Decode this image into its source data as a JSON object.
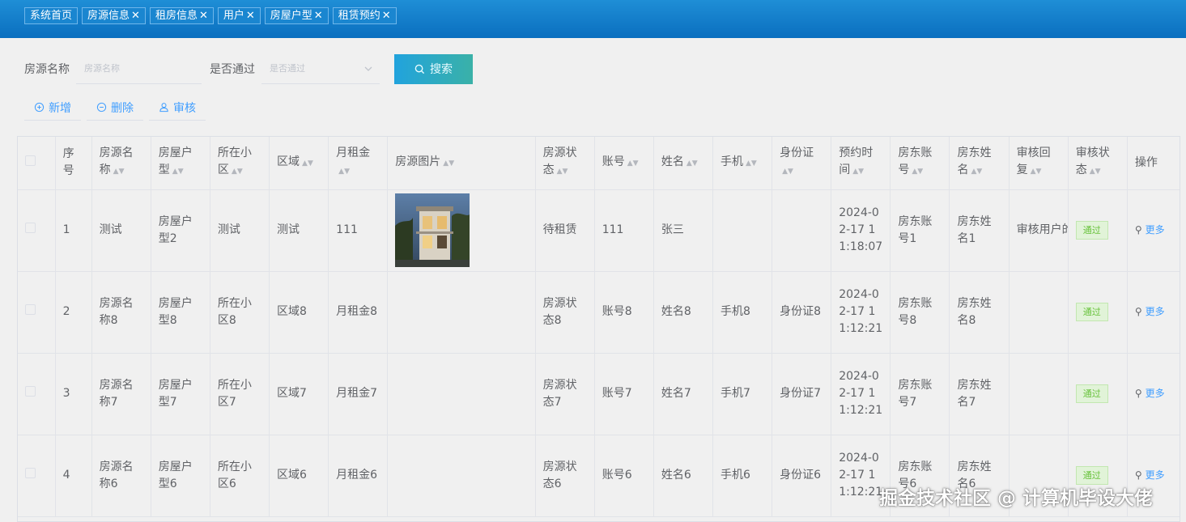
{
  "tabs": [
    {
      "label": "系统首页",
      "closable": false
    },
    {
      "label": "房源信息",
      "closable": true
    },
    {
      "label": "租房信息",
      "closable": true
    },
    {
      "label": "用户",
      "closable": true
    },
    {
      "label": "房屋户型",
      "closable": true
    },
    {
      "label": "租赁预约",
      "closable": true
    }
  ],
  "tab_close_glyph": "✕",
  "search": {
    "name_label": "房源名称",
    "name_placeholder": "房源名称",
    "pass_label": "是否通过",
    "pass_placeholder": "是否通过",
    "button_label": "搜索"
  },
  "toolbar": {
    "add_label": "新增",
    "delete_label": "删除",
    "audit_label": "审核"
  },
  "table": {
    "headers": [
      "序号",
      "房源名称",
      "房屋户型",
      "所在小区",
      "区域",
      "月租金",
      "房源图片",
      "房源状态",
      "账号",
      "姓名",
      "手机",
      "身份证",
      "预约时间",
      "房东账号",
      "房东姓名",
      "审核回复",
      "审核状态",
      "操作"
    ],
    "rows": [
      {
        "no": "1",
        "name": "测试",
        "type": "房屋户型2",
        "community": "测试",
        "area": "测试",
        "rent": "111",
        "has_image": true,
        "status": "待租赁",
        "account": "111",
        "real_name": "张三",
        "phone": "",
        "id_card": "",
        "time": "2024-02-17 11:18:07",
        "landlord_account": "房东账号1",
        "landlord_name": "房东姓名1",
        "reply": "审核用户的",
        "audit": "通过",
        "op": "更多"
      },
      {
        "no": "2",
        "name": "房源名称8",
        "type": "房屋户型8",
        "community": "所在小区8",
        "area": "区域8",
        "rent": "月租金8",
        "has_image": false,
        "status": "房源状态8",
        "account": "账号8",
        "real_name": "姓名8",
        "phone": "手机8",
        "id_card": "身份证8",
        "time": "2024-02-17 11:12:21",
        "landlord_account": "房东账号8",
        "landlord_name": "房东姓名8",
        "reply": "",
        "audit": "通过",
        "op": "更多"
      },
      {
        "no": "3",
        "name": "房源名称7",
        "type": "房屋户型7",
        "community": "所在小区7",
        "area": "区域7",
        "rent": "月租金7",
        "has_image": false,
        "status": "房源状态7",
        "account": "账号7",
        "real_name": "姓名7",
        "phone": "手机7",
        "id_card": "身份证7",
        "time": "2024-02-17 11:12:21",
        "landlord_account": "房东账号7",
        "landlord_name": "房东姓名7",
        "reply": "",
        "audit": "通过",
        "op": "更多"
      },
      {
        "no": "4",
        "name": "房源名称6",
        "type": "房屋户型6",
        "community": "所在小区6",
        "area": "区域6",
        "rent": "月租金6",
        "has_image": false,
        "status": "房源状态6",
        "account": "账号6",
        "real_name": "姓名6",
        "phone": "手机6",
        "id_card": "身份证6",
        "time": "2024-02-17 11:12:21",
        "landlord_account": "房东账号6",
        "landlord_name": "房东姓名6",
        "reply": "",
        "audit": "通过",
        "op": "更多"
      }
    ]
  },
  "watermark": "掘金技术社区 @ 计算机毕设大佬",
  "colors": {
    "topbar": "#0a7cc9",
    "accent": "#409eff",
    "success": "#67c23a"
  }
}
